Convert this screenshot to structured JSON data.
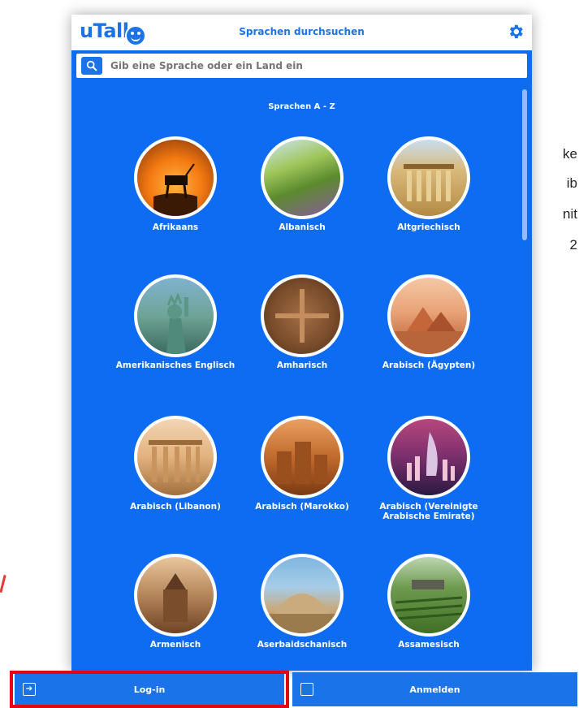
{
  "side_text": [
    "ke",
    "ib",
    "nit",
    "2"
  ],
  "app": {
    "logo": "uTalk",
    "title": "Sprachen durchsuchen",
    "search_placeholder": "Gib eine Sprache oder ein Land ein",
    "section_title": "Sprachen A - Z"
  },
  "languages": [
    {
      "label": "Afrikaans"
    },
    {
      "label": "Albanisch"
    },
    {
      "label": "Altgriechisch"
    },
    {
      "label": "Amerikanisches Englisch"
    },
    {
      "label": "Amharisch"
    },
    {
      "label": "Arabisch (Ägypten)"
    },
    {
      "label": "Arabisch (Libanon)"
    },
    {
      "label": "Arabisch (Marokko)"
    },
    {
      "label": "Arabisch (Vereinigte Arabische Emirate)"
    },
    {
      "label": "Armenisch"
    },
    {
      "label": "Aserbaidschanisch"
    },
    {
      "label": "Assamesisch"
    }
  ],
  "bottom": {
    "login_label": "Log-in",
    "register_label": "Anmelden"
  },
  "colors": {
    "app_bg": "#0d6cf2",
    "brand": "#1a73e8",
    "highlight": "#e30613"
  },
  "icons": {
    "search": "search-icon",
    "settings": "gear-icon",
    "login": "login-icon",
    "register": "user-card-icon"
  }
}
